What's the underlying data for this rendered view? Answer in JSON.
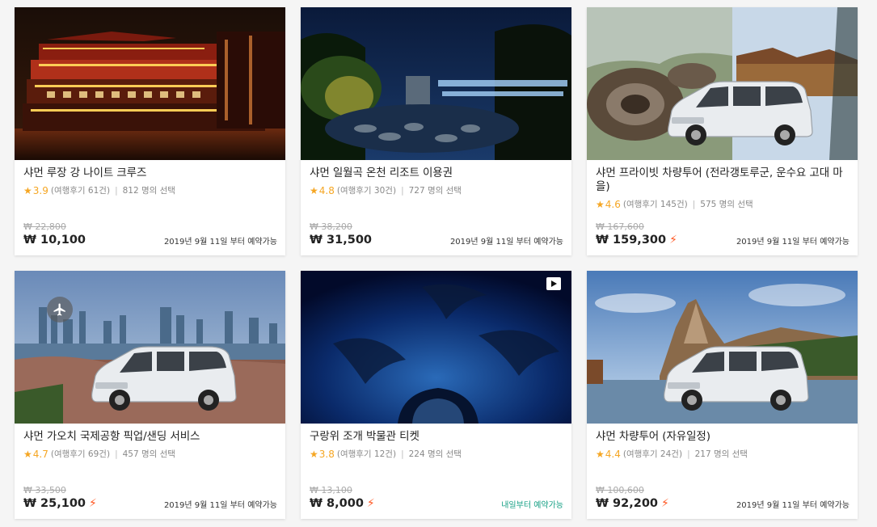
{
  "cards": [
    {
      "title": "샤먼 루장 강 나이트 크루즈",
      "rating": "3.9",
      "reviews": "(여행후기 61건)",
      "booked": "812 명의 선택",
      "original_price": "₩ 22,800",
      "price": "₩ 10,100",
      "availability": "2019년 9월 11일 부터 예약가능",
      "image": "night-cruise-photo"
    },
    {
      "title": "샤먼 일월곡 온천 리조트 이용권",
      "rating": "4.8",
      "reviews": "(여행후기 30건)",
      "booked": "727 명의 선택",
      "original_price": "₩ 38,200",
      "price": "₩ 31,500",
      "availability": "2019년 9월 11일 부터 예약가능",
      "image": "hot-spring-resort-photo"
    },
    {
      "title": "샤먼 프라이빗 차량투어 (전라갱토루군, 운수요 고대 마을)",
      "rating": "4.6",
      "reviews": "(여행후기 145건)",
      "booked": "575 명의 선택",
      "original_price": "₩ 167,600",
      "price": "₩ 159,300",
      "availability": "2019년 9월 11일 부터 예약가능",
      "image": "tulou-van-photo"
    },
    {
      "title": "샤먼 가오치 국제공항 픽업/샌딩 서비스",
      "rating": "4.7",
      "reviews": "(여행후기 69건)",
      "booked": "457 명의 선택",
      "original_price": "₩ 33,500",
      "price": "₩ 25,100",
      "availability": "2019년 9월 11일 부터 예약가능",
      "image": "city-skyline-van-photo"
    },
    {
      "title": "구랑위 조개 박물관 티켓",
      "rating": "3.8",
      "reviews": "(여행후기 12건)",
      "booked": "224 명의 선택",
      "original_price": "₩ 13,100",
      "price": "₩ 8,000",
      "availability": "내일부터 예약가능",
      "image": "aquarium-tunnel-photo"
    },
    {
      "title": "샤먼 차량투어 (자유일정)",
      "rating": "4.4",
      "reviews": "(여행후기 24건)",
      "booked": "217 명의 선택",
      "original_price": "₩ 100,600",
      "price": "₩ 92,200",
      "availability": "2019년 9월 11일 부터 예약가능",
      "image": "coastal-van-photo"
    }
  ],
  "icons": {
    "star": "★",
    "instant_confirm": "lightning-icon",
    "video": "play-icon",
    "airport": "airplane-icon"
  },
  "colors": {
    "star": "#f5a623",
    "bolt": "#ff5722",
    "tomorrow_green": "#16a085"
  }
}
